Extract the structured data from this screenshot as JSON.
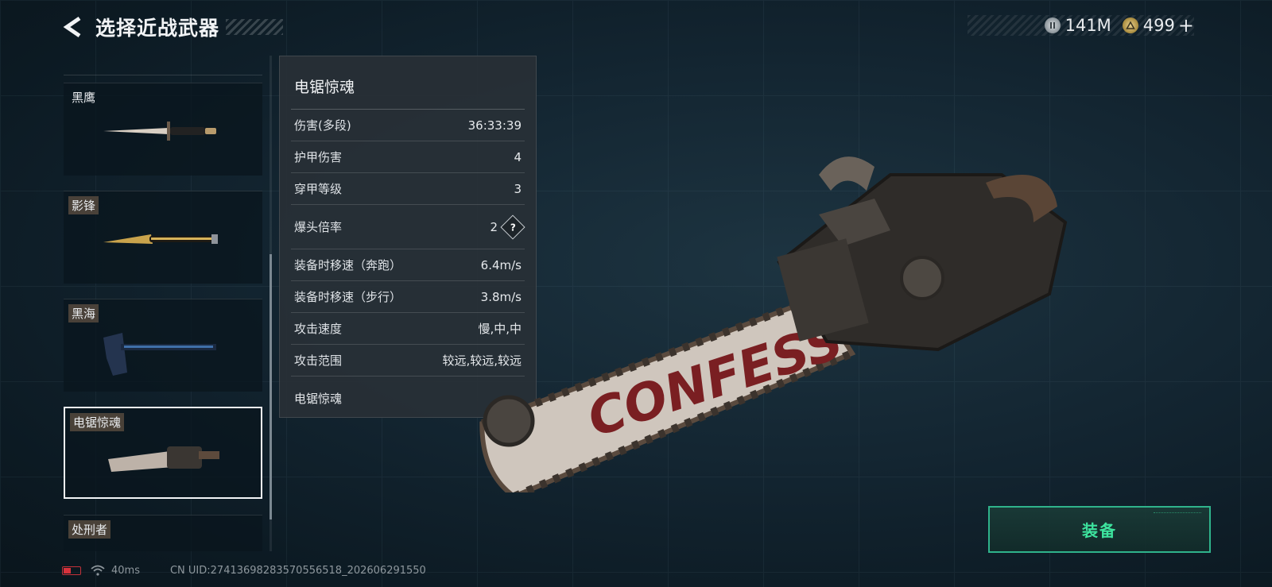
{
  "header": {
    "title": "选择近战武器"
  },
  "currency": [
    {
      "icon": "silver-coin-icon",
      "value": "141M"
    },
    {
      "icon": "gold-triangle-coin-icon",
      "value": "499"
    }
  ],
  "currency_add_label": "+",
  "weapons": [
    {
      "name": "黑鹰"
    },
    {
      "name": "影锋"
    },
    {
      "name": "黑海"
    },
    {
      "name": "电锯惊魂",
      "selected": true
    },
    {
      "name": "处刑者"
    }
  ],
  "panel": {
    "title": "电锯惊魂",
    "stats": [
      {
        "label": "伤害(多段)",
        "value": "36:33:39"
      },
      {
        "label": "护甲伤害",
        "value": "4"
      },
      {
        "label": "穿甲等级",
        "value": "3"
      },
      {
        "label": "爆头倍率",
        "value": "2",
        "help": "?"
      },
      {
        "label": "装备时移速（奔跑）",
        "value": "6.4m/s"
      },
      {
        "label": "装备时移速（步行）",
        "value": "3.8m/s"
      },
      {
        "label": "攻击速度",
        "value": "慢,中,中"
      },
      {
        "label": "攻击范围",
        "value": "较远,较远,较远"
      }
    ],
    "description": "电锯惊魂"
  },
  "weapon_graffiti": "CONFESS",
  "equip": {
    "label": "装备"
  },
  "status": {
    "ping": "40ms",
    "uid": "CN UID:27413698283570556518_202606291550"
  },
  "colors": {
    "accent_green": "#3de39e",
    "battery_red": "#d8323c"
  }
}
